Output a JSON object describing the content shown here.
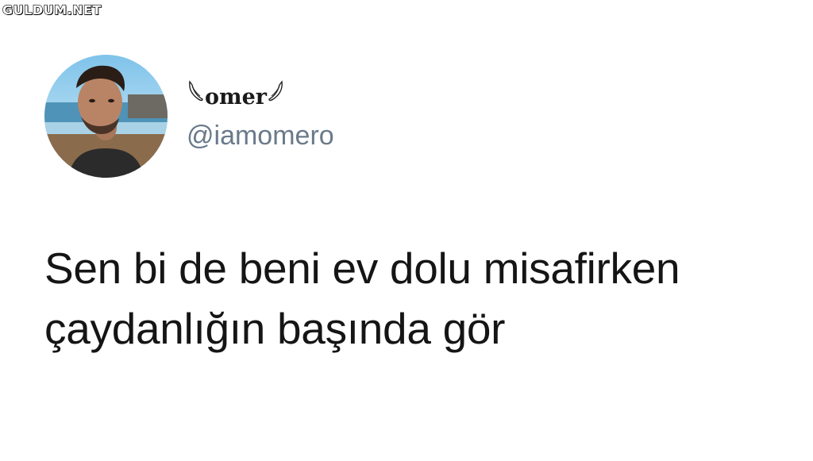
{
  "watermark": {
    "text": "GULDUM.NET"
  },
  "tweet": {
    "display_name": "omer",
    "handle": "@iamomero",
    "text_lines": [
      "Sen bi de beni ev dolu misafirken",
      "çaydanlığın başında gör"
    ]
  },
  "colors": {
    "background": "#ffffff",
    "text": "#151515",
    "handle": "#6a7a8b"
  },
  "icons": {
    "avatar": "profile-photo",
    "name_decoration": "wing-icon"
  }
}
